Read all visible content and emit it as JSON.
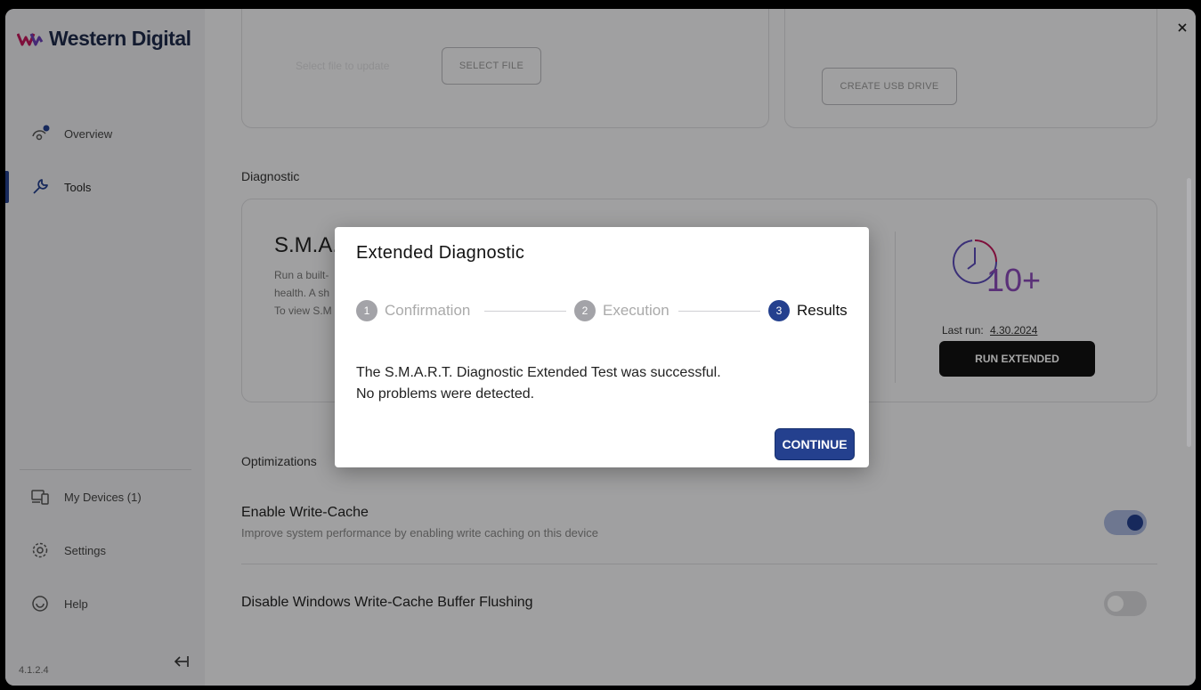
{
  "app": {
    "brand": "Western Digital",
    "version": "4.1.2.4"
  },
  "sidebar": {
    "nav": [
      {
        "label": "Overview",
        "icon": "overview-icon"
      },
      {
        "label": "Tools",
        "icon": "wrench-icon"
      }
    ],
    "bottom": [
      {
        "label": "My Devices (1)",
        "icon": "devices-icon"
      },
      {
        "label": "Settings",
        "icon": "gear-icon"
      },
      {
        "label": "Help",
        "icon": "help-icon"
      }
    ]
  },
  "main": {
    "firmware_card": {
      "select_file_label": "SELECT FILE",
      "hint": "Select file to update"
    },
    "usb_card": {
      "create_usb_label": "CREATE USB DRIVE"
    },
    "diagnostic": {
      "section_title": "Diagnostic",
      "card_title": "S.M.A.",
      "desc_line1": "Run a built-",
      "desc_line2": "health. A sh",
      "desc_line3": "To view S.M",
      "time_label": "10+",
      "last_run_label": "Last run:",
      "last_run_date": "4.30.2024",
      "run_extended_label": "RUN EXTENDED"
    },
    "optimizations": {
      "section_title": "Optimizations",
      "write_cache_title": "Enable Write-Cache",
      "write_cache_desc": "Improve system performance by enabling write caching on this device",
      "write_cache_on": true,
      "flush_title": "Disable Windows Write-Cache Buffer Flushing",
      "flush_on": false
    }
  },
  "modal": {
    "title": "Extended Diagnostic",
    "steps": [
      {
        "num": "1",
        "label": "Confirmation"
      },
      {
        "num": "2",
        "label": "Execution"
      },
      {
        "num": "3",
        "label": "Results"
      }
    ],
    "message_line1": "The S.M.A.R.T. Diagnostic Extended Test was successful.",
    "message_line2": "No problems were detected.",
    "continue_label": "CONTINUE"
  },
  "colors": {
    "accent": "#24408e",
    "run_button": "#111111"
  }
}
